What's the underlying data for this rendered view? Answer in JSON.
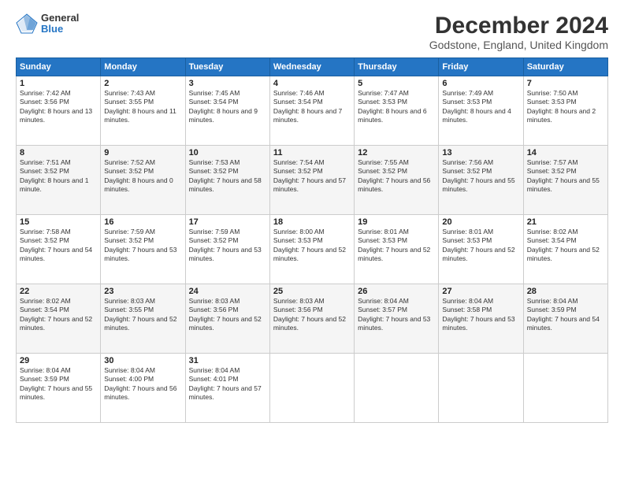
{
  "logo": {
    "general": "General",
    "blue": "Blue"
  },
  "title": "December 2024",
  "subtitle": "Godstone, England, United Kingdom",
  "headers": [
    "Sunday",
    "Monday",
    "Tuesday",
    "Wednesday",
    "Thursday",
    "Friday",
    "Saturday"
  ],
  "weeks": [
    [
      {
        "day": "1",
        "sunrise": "Sunrise: 7:42 AM",
        "sunset": "Sunset: 3:56 PM",
        "daylight": "Daylight: 8 hours and 13 minutes."
      },
      {
        "day": "2",
        "sunrise": "Sunrise: 7:43 AM",
        "sunset": "Sunset: 3:55 PM",
        "daylight": "Daylight: 8 hours and 11 minutes."
      },
      {
        "day": "3",
        "sunrise": "Sunrise: 7:45 AM",
        "sunset": "Sunset: 3:54 PM",
        "daylight": "Daylight: 8 hours and 9 minutes."
      },
      {
        "day": "4",
        "sunrise": "Sunrise: 7:46 AM",
        "sunset": "Sunset: 3:54 PM",
        "daylight": "Daylight: 8 hours and 7 minutes."
      },
      {
        "day": "5",
        "sunrise": "Sunrise: 7:47 AM",
        "sunset": "Sunset: 3:53 PM",
        "daylight": "Daylight: 8 hours and 6 minutes."
      },
      {
        "day": "6",
        "sunrise": "Sunrise: 7:49 AM",
        "sunset": "Sunset: 3:53 PM",
        "daylight": "Daylight: 8 hours and 4 minutes."
      },
      {
        "day": "7",
        "sunrise": "Sunrise: 7:50 AM",
        "sunset": "Sunset: 3:53 PM",
        "daylight": "Daylight: 8 hours and 2 minutes."
      }
    ],
    [
      {
        "day": "8",
        "sunrise": "Sunrise: 7:51 AM",
        "sunset": "Sunset: 3:52 PM",
        "daylight": "Daylight: 8 hours and 1 minute."
      },
      {
        "day": "9",
        "sunrise": "Sunrise: 7:52 AM",
        "sunset": "Sunset: 3:52 PM",
        "daylight": "Daylight: 8 hours and 0 minutes."
      },
      {
        "day": "10",
        "sunrise": "Sunrise: 7:53 AM",
        "sunset": "Sunset: 3:52 PM",
        "daylight": "Daylight: 7 hours and 58 minutes."
      },
      {
        "day": "11",
        "sunrise": "Sunrise: 7:54 AM",
        "sunset": "Sunset: 3:52 PM",
        "daylight": "Daylight: 7 hours and 57 minutes."
      },
      {
        "day": "12",
        "sunrise": "Sunrise: 7:55 AM",
        "sunset": "Sunset: 3:52 PM",
        "daylight": "Daylight: 7 hours and 56 minutes."
      },
      {
        "day": "13",
        "sunrise": "Sunrise: 7:56 AM",
        "sunset": "Sunset: 3:52 PM",
        "daylight": "Daylight: 7 hours and 55 minutes."
      },
      {
        "day": "14",
        "sunrise": "Sunrise: 7:57 AM",
        "sunset": "Sunset: 3:52 PM",
        "daylight": "Daylight: 7 hours and 55 minutes."
      }
    ],
    [
      {
        "day": "15",
        "sunrise": "Sunrise: 7:58 AM",
        "sunset": "Sunset: 3:52 PM",
        "daylight": "Daylight: 7 hours and 54 minutes."
      },
      {
        "day": "16",
        "sunrise": "Sunrise: 7:59 AM",
        "sunset": "Sunset: 3:52 PM",
        "daylight": "Daylight: 7 hours and 53 minutes."
      },
      {
        "day": "17",
        "sunrise": "Sunrise: 7:59 AM",
        "sunset": "Sunset: 3:52 PM",
        "daylight": "Daylight: 7 hours and 53 minutes."
      },
      {
        "day": "18",
        "sunrise": "Sunrise: 8:00 AM",
        "sunset": "Sunset: 3:53 PM",
        "daylight": "Daylight: 7 hours and 52 minutes."
      },
      {
        "day": "19",
        "sunrise": "Sunrise: 8:01 AM",
        "sunset": "Sunset: 3:53 PM",
        "daylight": "Daylight: 7 hours and 52 minutes."
      },
      {
        "day": "20",
        "sunrise": "Sunrise: 8:01 AM",
        "sunset": "Sunset: 3:53 PM",
        "daylight": "Daylight: 7 hours and 52 minutes."
      },
      {
        "day": "21",
        "sunrise": "Sunrise: 8:02 AM",
        "sunset": "Sunset: 3:54 PM",
        "daylight": "Daylight: 7 hours and 52 minutes."
      }
    ],
    [
      {
        "day": "22",
        "sunrise": "Sunrise: 8:02 AM",
        "sunset": "Sunset: 3:54 PM",
        "daylight": "Daylight: 7 hours and 52 minutes."
      },
      {
        "day": "23",
        "sunrise": "Sunrise: 8:03 AM",
        "sunset": "Sunset: 3:55 PM",
        "daylight": "Daylight: 7 hours and 52 minutes."
      },
      {
        "day": "24",
        "sunrise": "Sunrise: 8:03 AM",
        "sunset": "Sunset: 3:56 PM",
        "daylight": "Daylight: 7 hours and 52 minutes."
      },
      {
        "day": "25",
        "sunrise": "Sunrise: 8:03 AM",
        "sunset": "Sunset: 3:56 PM",
        "daylight": "Daylight: 7 hours and 52 minutes."
      },
      {
        "day": "26",
        "sunrise": "Sunrise: 8:04 AM",
        "sunset": "Sunset: 3:57 PM",
        "daylight": "Daylight: 7 hours and 53 minutes."
      },
      {
        "day": "27",
        "sunrise": "Sunrise: 8:04 AM",
        "sunset": "Sunset: 3:58 PM",
        "daylight": "Daylight: 7 hours and 53 minutes."
      },
      {
        "day": "28",
        "sunrise": "Sunrise: 8:04 AM",
        "sunset": "Sunset: 3:59 PM",
        "daylight": "Daylight: 7 hours and 54 minutes."
      }
    ],
    [
      {
        "day": "29",
        "sunrise": "Sunrise: 8:04 AM",
        "sunset": "Sunset: 3:59 PM",
        "daylight": "Daylight: 7 hours and 55 minutes."
      },
      {
        "day": "30",
        "sunrise": "Sunrise: 8:04 AM",
        "sunset": "Sunset: 4:00 PM",
        "daylight": "Daylight: 7 hours and 56 minutes."
      },
      {
        "day": "31",
        "sunrise": "Sunrise: 8:04 AM",
        "sunset": "Sunset: 4:01 PM",
        "daylight": "Daylight: 7 hours and 57 minutes."
      },
      null,
      null,
      null,
      null
    ]
  ]
}
